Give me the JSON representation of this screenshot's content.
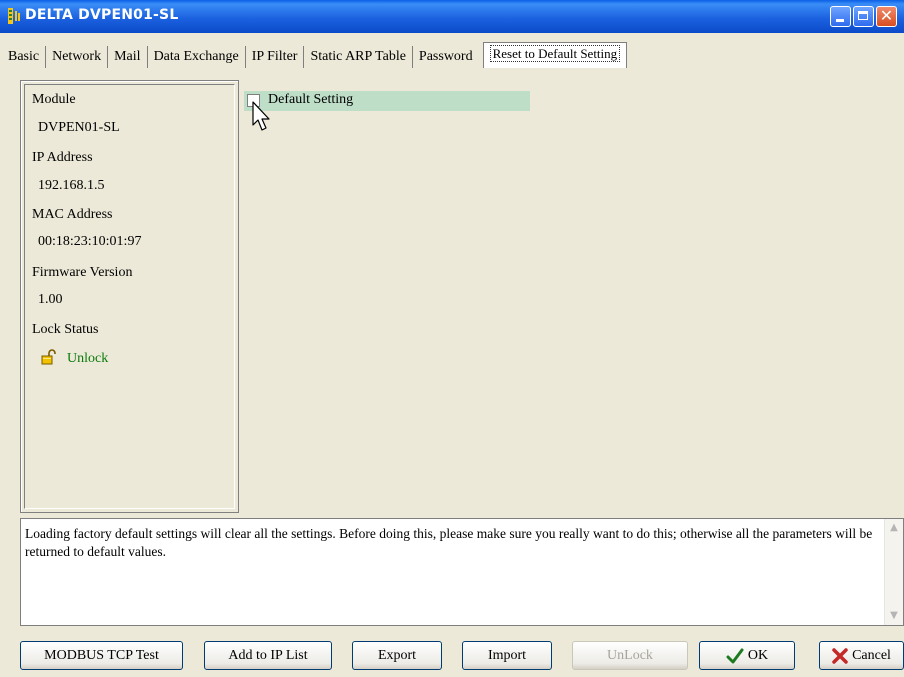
{
  "window": {
    "title": "DELTA DVPEN01-SL"
  },
  "tabs": [
    {
      "label": "Basic"
    },
    {
      "label": "Network"
    },
    {
      "label": "Mail"
    },
    {
      "label": "Data Exchange"
    },
    {
      "label": "IP Filter"
    },
    {
      "label": "Static ARP Table"
    },
    {
      "label": "Password"
    },
    {
      "label": "Reset to Default Setting",
      "active": true
    }
  ],
  "info_panel": {
    "module_label": "Module",
    "module_value": "DVPEN01-SL",
    "ip_label": "IP Address",
    "ip_value": "192.168.1.5",
    "mac_label": "MAC Address",
    "mac_value": "00:18:23:10:01:97",
    "firmware_label": "Firmware Version",
    "firmware_value": "1.00",
    "lock_label": "Lock Status",
    "lock_value": "Unlock"
  },
  "reset": {
    "checkbox_label": "Default Setting",
    "checked": false
  },
  "description": "Loading factory default settings will clear all the settings. Before doing this, please make sure you really want to do this; otherwise all the parameters will be returned to default values.",
  "buttons": {
    "modbus": "MODBUS TCP Test",
    "add_ip": "Add to IP List",
    "export": "Export",
    "import": "Import",
    "unlock": "UnLock",
    "ok": "OK",
    "cancel": "Cancel"
  },
  "colors": {
    "titlebar": "#0A5FE6",
    "face": "#ECE9D8",
    "highlight_row": "#BEDEC8",
    "unlock_text": "#0A7A0A"
  }
}
